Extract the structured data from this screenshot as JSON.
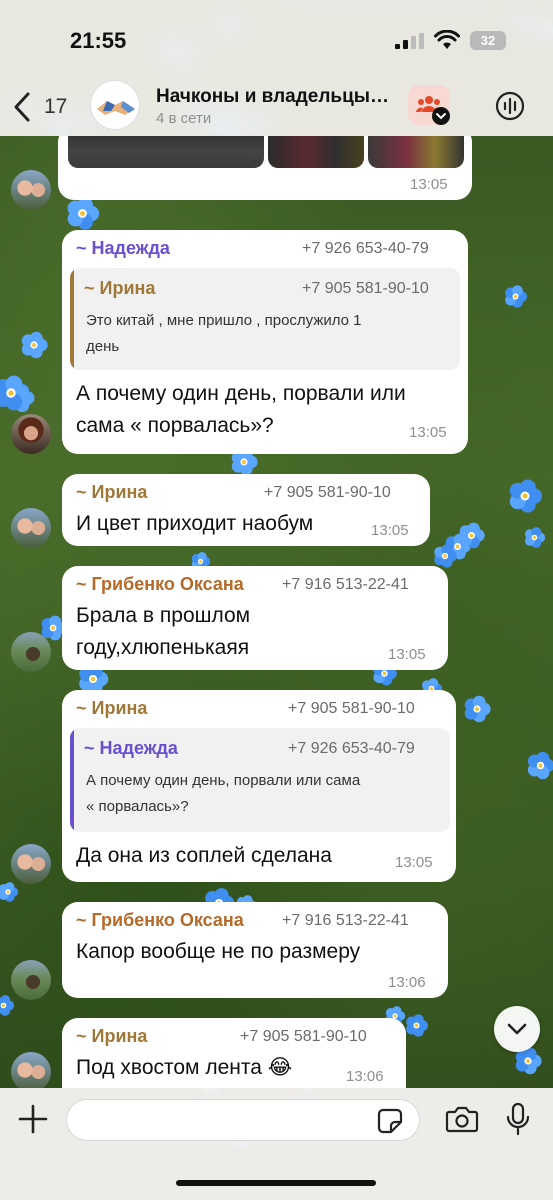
{
  "status_bar": {
    "time": "21:55",
    "battery": "32"
  },
  "header": {
    "back_count": "17",
    "title": "Начконы и владельцы…",
    "subtitle": "4 в сети"
  },
  "colors": {
    "irina": "#a07838",
    "nadezhda": "#6a4fd0",
    "oksana": "#b56a2a",
    "accent": "#4a74c9"
  },
  "icons": [
    "back-chevron-icon",
    "group-avatar-handshake",
    "community-icon",
    "voice-chat-icon",
    "plus-icon",
    "sticker-icon",
    "camera-icon",
    "microphone-icon",
    "chevron-down-icon"
  ],
  "messages": [
    {
      "time": "13:05"
    },
    {
      "sender": "~ Надежда",
      "phone": "+7 926 653-40-79",
      "quote": {
        "sender": "~ Ирина",
        "phone": "+7 905 581-90-10",
        "text_l1": "Это китай , мне пришло , прослужило 1",
        "text_l2": "день"
      },
      "text_l1": "А почему один день, порвали или",
      "text_l2": "сама « порвалась»?",
      "time": "13:05"
    },
    {
      "sender": "~ Ирина",
      "phone": "+7 905 581-90-10",
      "text_l1": "И цвет приходит наобум",
      "time": "13:05"
    },
    {
      "sender": "~ Грибенко Оксана",
      "phone": "+7 916 513-22-41",
      "text_l1": "Брала в прошлом",
      "text_l2": "году,хлюпенькаяя",
      "time": "13:05"
    },
    {
      "sender": "~ Ирина",
      "phone": "+7 905 581-90-10",
      "quote": {
        "sender": "~ Надежда",
        "phone": "+7 926 653-40-79",
        "text_l1": "А почему один день, порвали или сама",
        "text_l2": "« порвалась»?"
      },
      "text_l1": "Да она из соплей сделана",
      "time": "13:05"
    },
    {
      "sender": "~ Грибенко Оксана",
      "phone": "+7 916 513-22-41",
      "text_l1": "Капор вообще не по размеру",
      "time": "13:06"
    },
    {
      "sender": "~ Ирина",
      "phone": "+7 905 581-90-10",
      "text_l1": "Под хвостом лента 😂",
      "time": "13:06"
    }
  ],
  "composer": {
    "placeholder": ""
  }
}
